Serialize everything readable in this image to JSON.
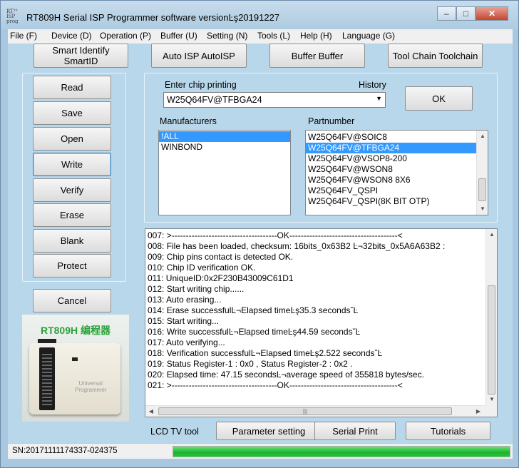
{
  "window": {
    "title": "RT809H Serial ISP Programmer software versionĿş20191227",
    "icon_text": "RT¹⁹\nISP\nprog",
    "controls": {
      "minimize": "–",
      "maximize": "□",
      "close": "✕"
    }
  },
  "menu": [
    "File (F)",
    "Device (D)",
    "Operation (P)",
    "Buffer (U)",
    "Setting (N)",
    "Tools (L)",
    "Help (H)",
    "Language (G)"
  ],
  "top_buttons": [
    "Smart Identify SmartID",
    "Auto ISP AutoISP",
    "Buffer Buffer",
    "Tool Chain Toolchain"
  ],
  "side_buttons": [
    "Read",
    "Save",
    "Open",
    "Write",
    "Verify",
    "Erase",
    "Blank",
    "Protect"
  ],
  "cancel_label": "Cancel",
  "chip": {
    "label": "Enter chip printing",
    "history_label": "History",
    "value": "W25Q64FV@TFBGA24",
    "ok_label": "OK"
  },
  "manufacturers": {
    "label": "Manufacturers",
    "items": [
      "!ALL",
      "WINBOND"
    ],
    "selected": 0
  },
  "partnumber": {
    "label": "Partnumber",
    "items": [
      "W25Q64FV@SOIC8",
      "W25Q64FV@TFBGA24",
      "W25Q64FV@VSOP8-200",
      "W25Q64FV@WSON8",
      "W25Q64FV@WSON8 8X6",
      "W25Q64FV_QSPI",
      "W25Q64FV_QSPI(8K BIT OTP)"
    ],
    "selected": 1
  },
  "log": [
    "007:  >-------------------------------------OK--------------------------------------<",
    "008:  File has been loaded, checksum: 16bits_0x63B2 Ŀ¬32bits_0x5A6A63B2 :",
    "009:  Chip pins contact is detected OK.",
    "010:  Chip ID verification OK.",
    "011:  UniqueID:0x2F230B43009C61D1",
    "012:  Start writing chip......",
    "013:  Auto erasing...",
    "014:  Erase successfulĿ¬Elapsed timeĿş35.3 secondsˇĿ",
    "015:  Start writing...",
    "016:  Write successfulĿ¬Elapsed timeĿş44.59 secondsˇĿ",
    "017:  Auto verifying...",
    "018:  Verification successfulĿ¬Elapsed timeĿş2.522 secondsˇĿ",
    "019:  Status Register-1 : 0x0 , Status Register-2 : 0x2 .",
    "020:  Elapsed time: 47.15 secondsĿ¬average speed of 355818 bytes/sec.",
    "021:  >-------------------------------------OK--------------------------------------<"
  ],
  "bottom": {
    "lcd_label": "LCD TV tool",
    "buttons": [
      "Parameter setting",
      "Serial Print",
      "Tutorials"
    ]
  },
  "status": {
    "serial": "SN:20171111174337-024375",
    "progress": 1.0
  },
  "photo": {
    "title": "RT809H 编程器",
    "device_text": "Universal\nProgrammer"
  },
  "colors": {
    "background": "#b9d7ea",
    "selection": "#3399ff",
    "progress": "#17b52b",
    "photo_title": "#2aa23a"
  }
}
